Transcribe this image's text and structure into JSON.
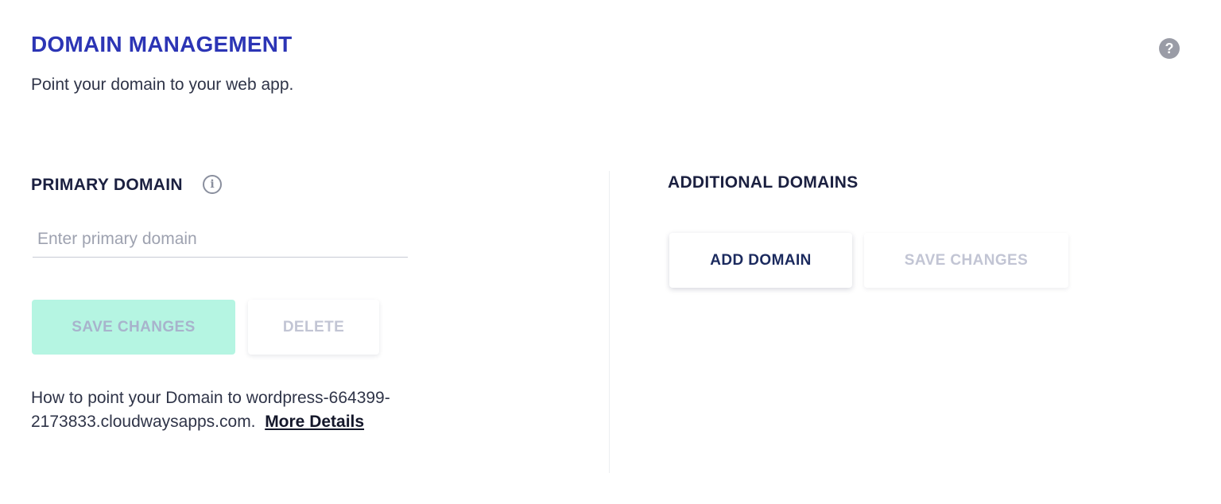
{
  "header": {
    "title": "DOMAIN MANAGEMENT",
    "subtitle": "Point your domain to your web app.",
    "help_icon": "question-circle-icon",
    "help_glyph": "?"
  },
  "primary": {
    "heading": "PRIMARY DOMAIN",
    "info_icon": "info-circle-icon",
    "info_glyph": "i",
    "input": {
      "placeholder": "Enter primary domain",
      "value": ""
    },
    "save_label": "SAVE CHANGES",
    "delete_label": "DELETE",
    "howto_text": "How to point your Domain to wordpress-664399-2173833.cloudwaysapps.com.",
    "more_details_label": "More Details"
  },
  "additional": {
    "heading": "ADDITIONAL DOMAINS",
    "add_label": "ADD DOMAIN",
    "save_label": "SAVE CHANGES"
  },
  "colors": {
    "title": "#2c35b5",
    "save_primary_bg": "#b5f5e2",
    "disabled_text": "#c2c5d4",
    "help_icon_bg": "#9a9ca6"
  }
}
